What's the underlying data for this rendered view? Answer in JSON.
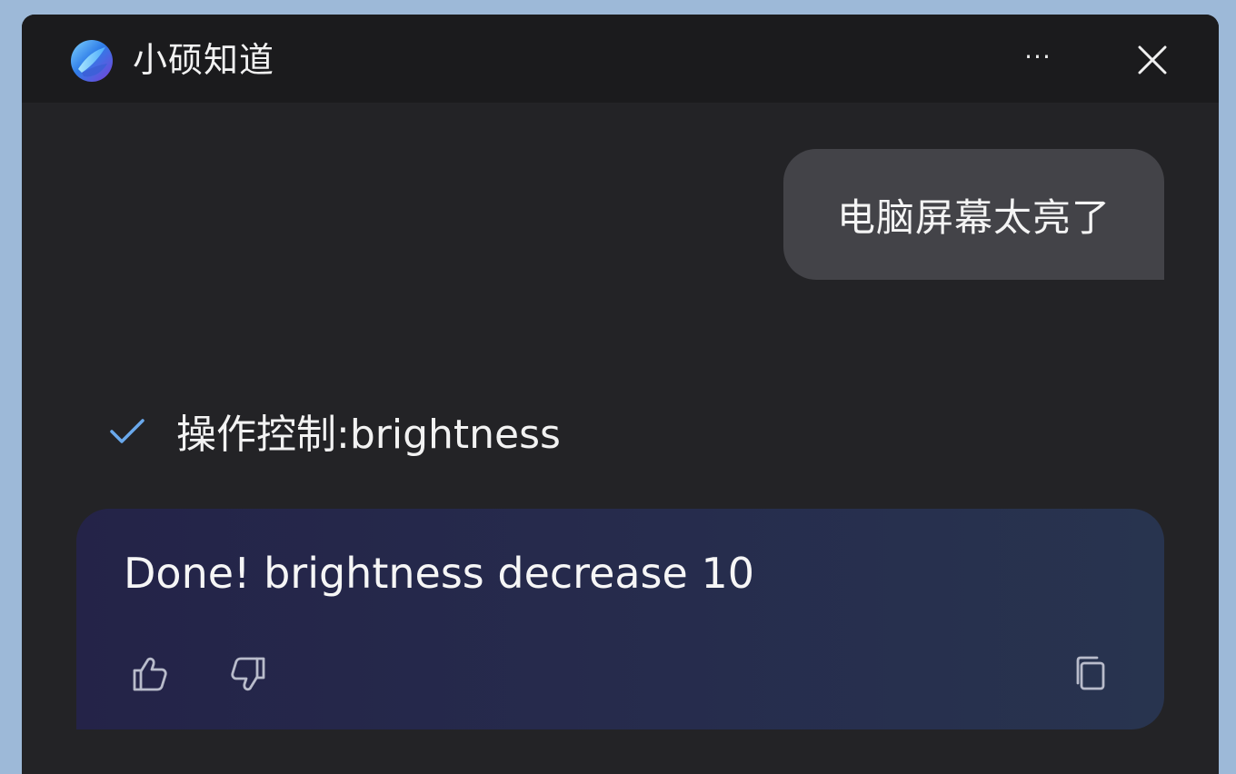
{
  "app": {
    "title": "小硕知道",
    "more_label": "···"
  },
  "conversation": {
    "user_message": "电脑屏幕太亮了",
    "action_status": "操作控制:brightness",
    "response_text": "Done! brightness decrease 10"
  },
  "colors": {
    "window_bg": "#232326",
    "titlebar_bg": "#1b1b1d",
    "user_bubble": "#434348",
    "check_accent": "#6aa9ec",
    "response_card_start": "#242348",
    "response_card_end": "#28344f"
  },
  "icons": {
    "logo": "copilot-logo-icon",
    "more": "more-options-icon",
    "close": "close-icon",
    "check": "check-icon",
    "like": "thumbs-up-icon",
    "dislike": "thumbs-down-icon",
    "copy": "copy-icon"
  }
}
